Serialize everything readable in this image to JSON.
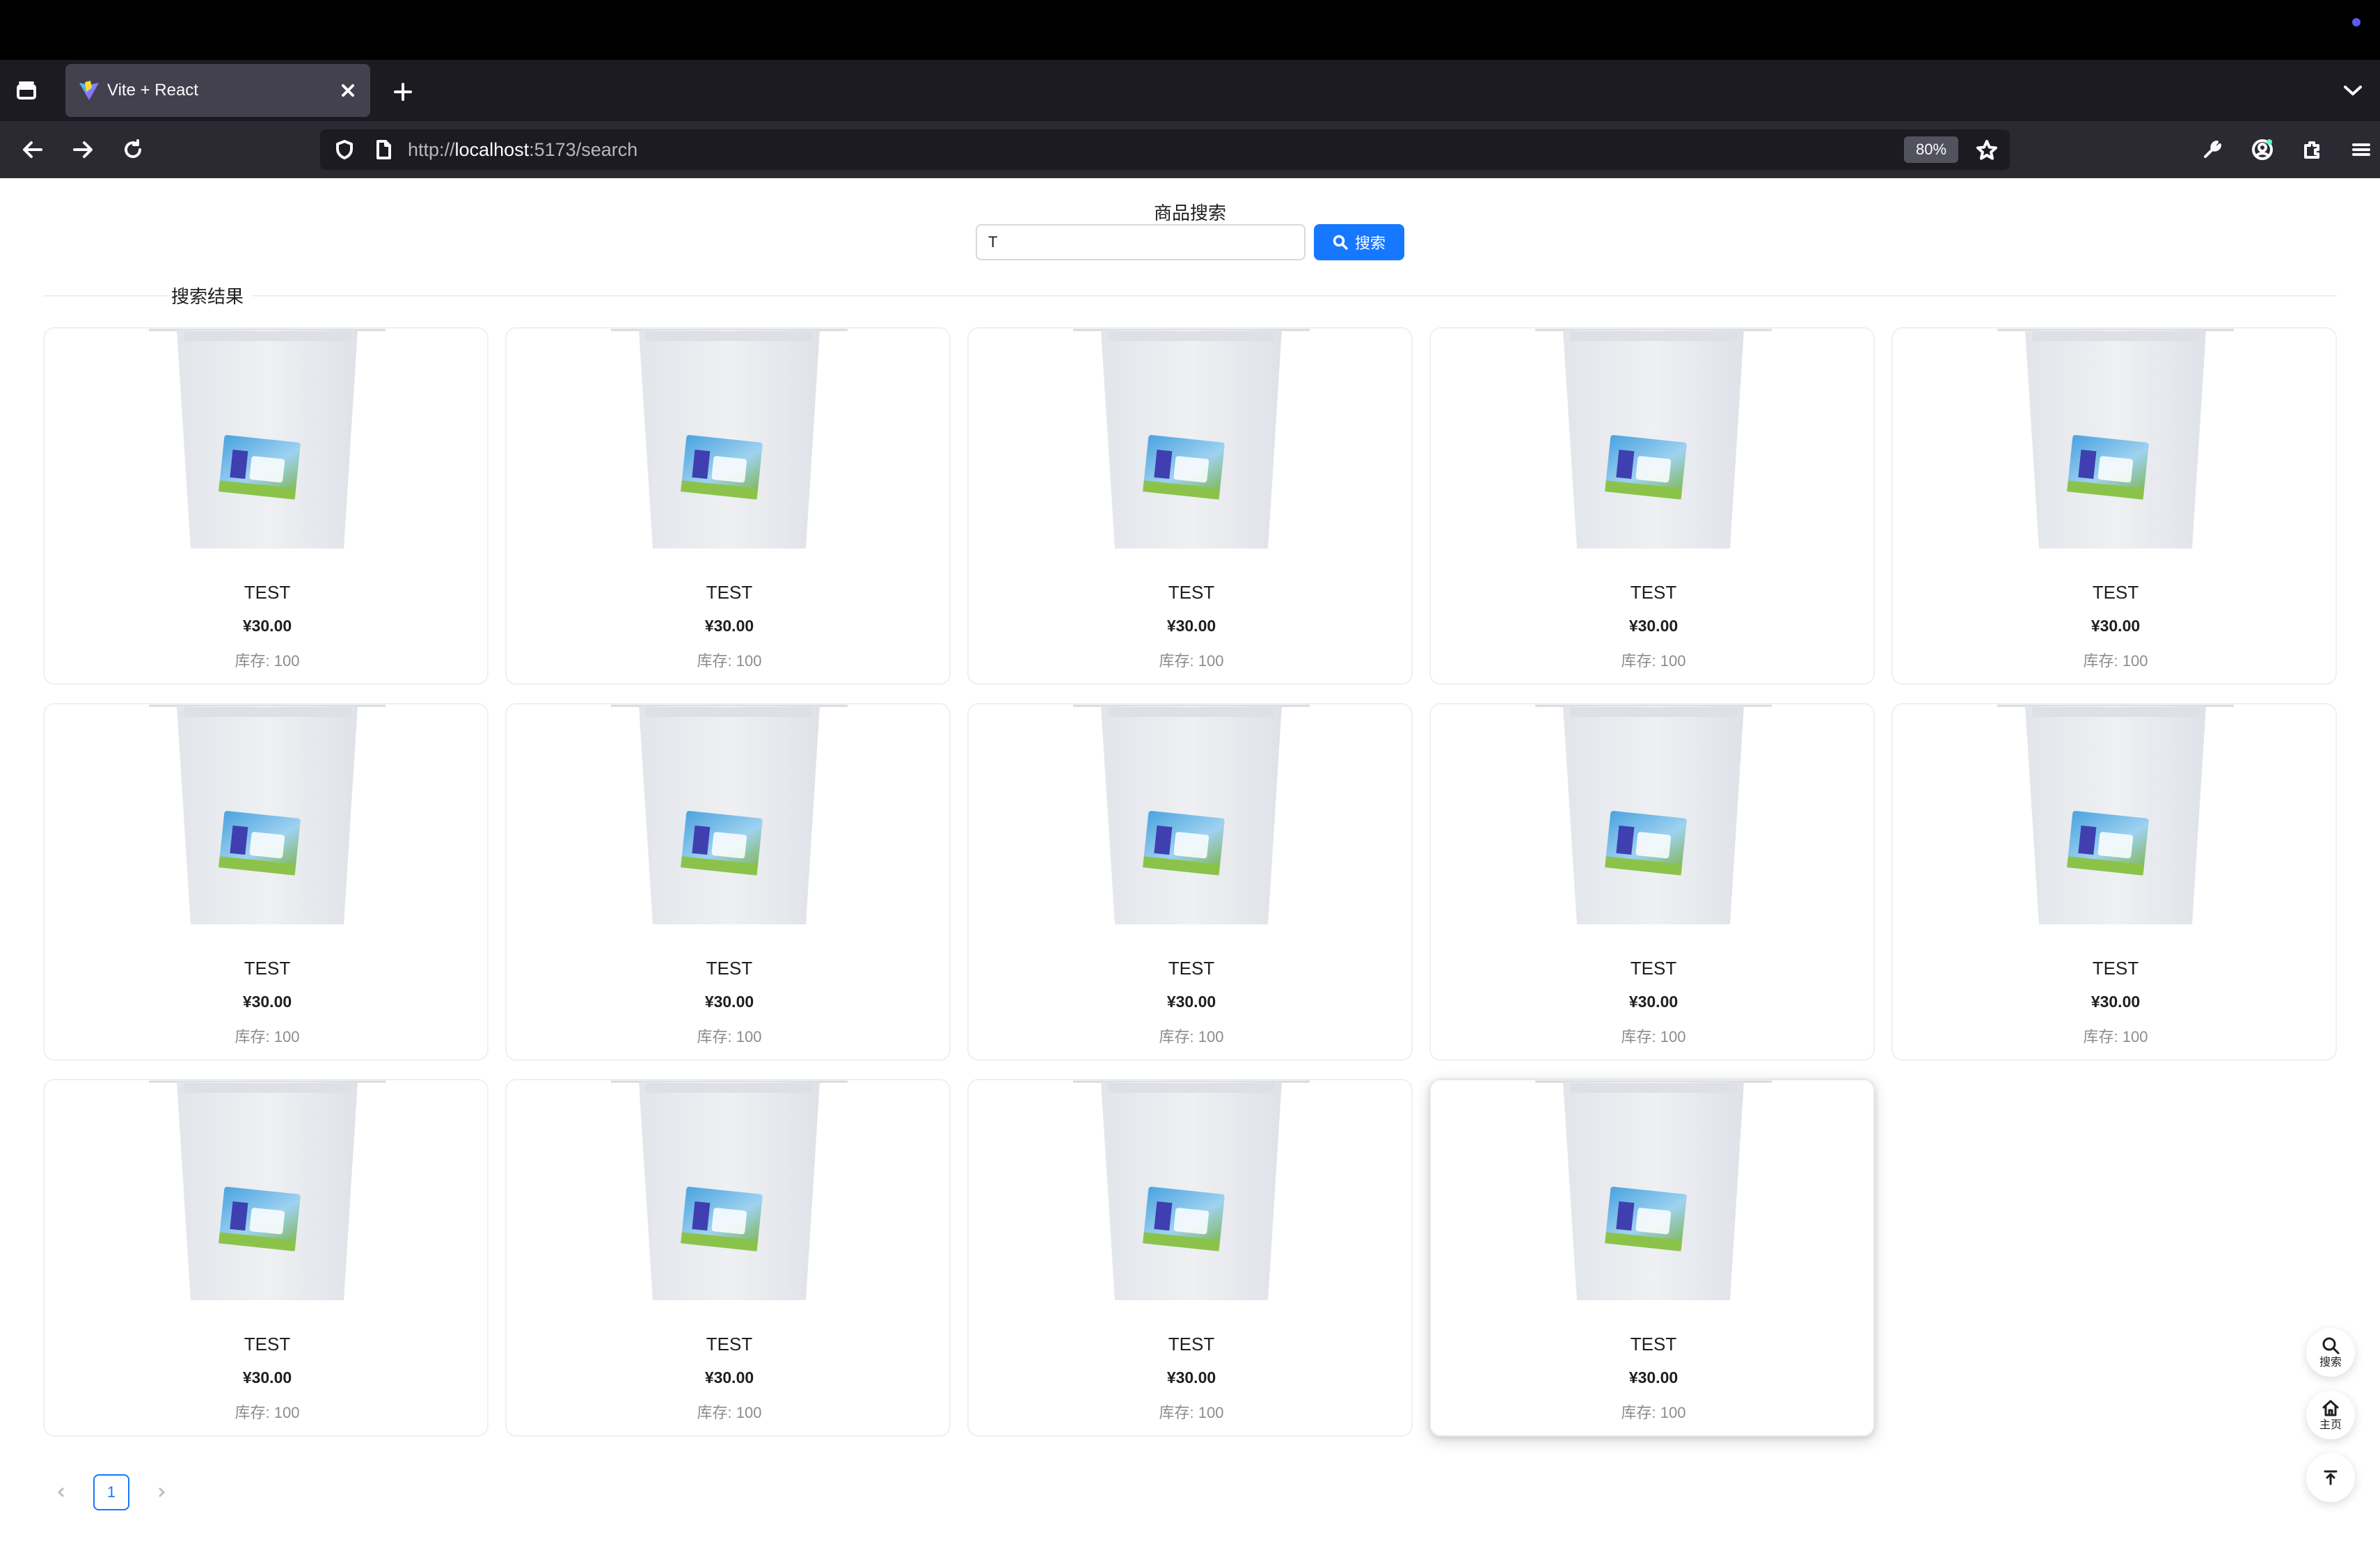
{
  "browser": {
    "tab_title": "Vite + React",
    "url_prefix": "http://",
    "url_host": "localhost",
    "url_rest": ":5173/search",
    "zoom": "80%"
  },
  "search": {
    "title": "商品搜索",
    "input_value": "T",
    "button_label": "搜索"
  },
  "results": {
    "title": "搜索结果",
    "items": [
      {
        "name": "TEST",
        "price": "¥30.00",
        "stock": "库存: 100"
      },
      {
        "name": "TEST",
        "price": "¥30.00",
        "stock": "库存: 100"
      },
      {
        "name": "TEST",
        "price": "¥30.00",
        "stock": "库存: 100"
      },
      {
        "name": "TEST",
        "price": "¥30.00",
        "stock": "库存: 100"
      },
      {
        "name": "TEST",
        "price": "¥30.00",
        "stock": "库存: 100"
      },
      {
        "name": "TEST",
        "price": "¥30.00",
        "stock": "库存: 100"
      },
      {
        "name": "TEST",
        "price": "¥30.00",
        "stock": "库存: 100"
      },
      {
        "name": "TEST",
        "price": "¥30.00",
        "stock": "库存: 100"
      },
      {
        "name": "TEST",
        "price": "¥30.00",
        "stock": "库存: 100"
      },
      {
        "name": "TEST",
        "price": "¥30.00",
        "stock": "库存: 100"
      },
      {
        "name": "TEST",
        "price": "¥30.00",
        "stock": "库存: 100"
      },
      {
        "name": "TEST",
        "price": "¥30.00",
        "stock": "库存: 100"
      },
      {
        "name": "TEST",
        "price": "¥30.00",
        "stock": "库存: 100"
      },
      {
        "name": "TEST",
        "price": "¥30.00",
        "stock": "库存: 100"
      }
    ]
  },
  "pagination": {
    "current_page": "1"
  },
  "float_buttons": {
    "search_label": "搜索",
    "home_label": "主页"
  },
  "colors": {
    "primary": "#1677ff",
    "chrome_dark": "#1c1b22",
    "chrome_nav": "#2b2a33",
    "tab_active": "#42414d"
  },
  "icons": [
    "tab-list-icon",
    "vite-logo-icon",
    "close-icon",
    "plus-icon",
    "chevron-down-icon",
    "back-arrow-icon",
    "forward-arrow-icon",
    "reload-icon",
    "shield-icon",
    "page-icon",
    "star-icon",
    "wrench-icon",
    "account-icon",
    "extensions-icon",
    "hamburger-menu-icon",
    "search-icon",
    "home-icon",
    "back-to-top-icon",
    "chevron-left-icon",
    "chevron-right-icon"
  ]
}
